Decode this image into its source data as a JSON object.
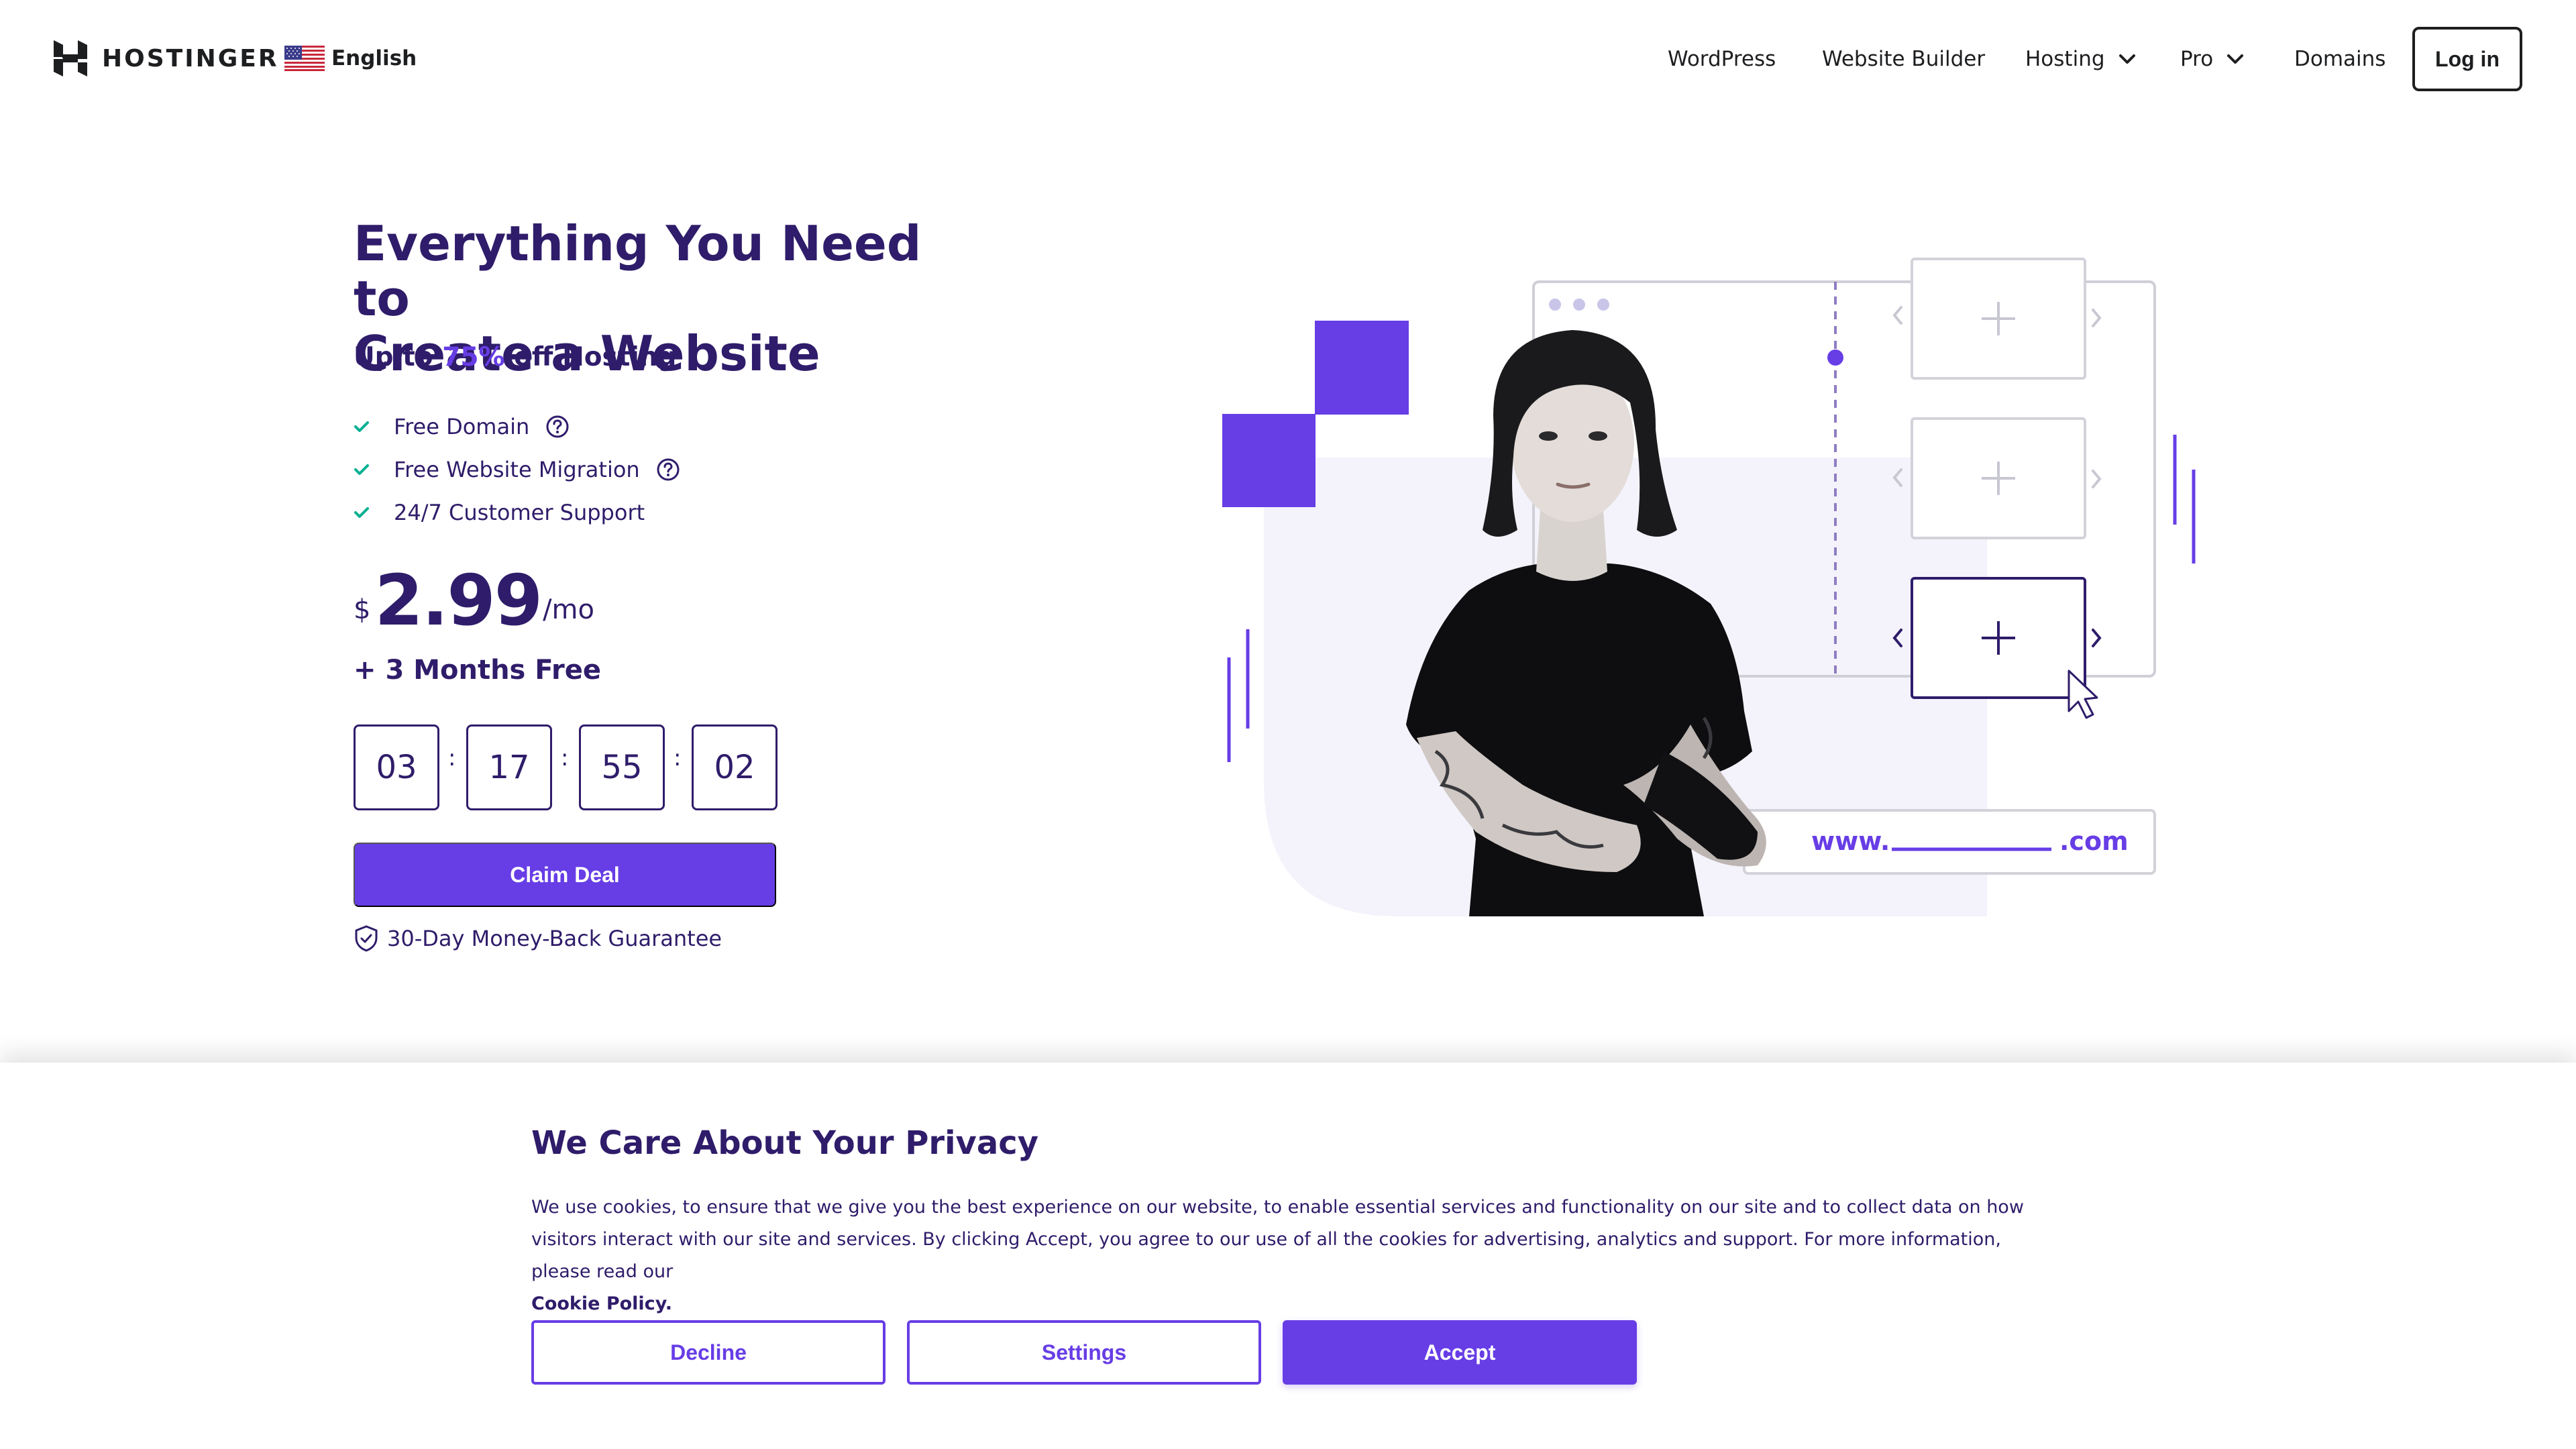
{
  "brand": {
    "name": "HOSTINGER"
  },
  "language": {
    "label": "English",
    "flag_icon": "us-flag-icon"
  },
  "nav": {
    "items": [
      {
        "label": "WordPress",
        "has_dropdown": false
      },
      {
        "label": "Website Builder",
        "has_dropdown": false
      },
      {
        "label": "Hosting",
        "has_dropdown": true
      },
      {
        "label": "Pro",
        "has_dropdown": true
      },
      {
        "label": "Domains",
        "has_dropdown": false
      }
    ],
    "login_label": "Log in"
  },
  "hero": {
    "title_line1": "Everything You Need to",
    "title_line2": "Create a Website",
    "subtitle_prefix": "Up to ",
    "subtitle_accent": "75%",
    "subtitle_suffix": " off Hosting",
    "features": [
      {
        "label": "Free Domain",
        "has_help": true
      },
      {
        "label": "Free Website Migration",
        "has_help": true
      },
      {
        "label": "24/7 Customer Support",
        "has_help": false
      }
    ],
    "price": {
      "currency": "$",
      "amount": "2.99",
      "period": "/mo"
    },
    "bonus": "+ 3 Months Free",
    "countdown": {
      "values": [
        "03",
        "17",
        "55",
        "02"
      ],
      "separator": ":"
    },
    "cta_label": "Claim Deal",
    "guarantee": "30-Day Money-Back Guarantee"
  },
  "illustration": {
    "domain_prefix": "www.",
    "domain_suffix": ".com"
  },
  "cookie_banner": {
    "title": "We Care About Your Privacy",
    "text": "We use cookies, to ensure that we give you the best experience on our website, to enable essential services and functionality on our site and to collect data on how visitors interact with our site and services. By clicking Accept, you agree to our use of all the cookies for advertising, analytics and support. For more information, please read our",
    "link_label": "Cookie Policy.",
    "decline_label": "Decline",
    "settings_label": "Settings",
    "accept_label": "Accept"
  },
  "colors": {
    "primary": "#673de6",
    "dark_text": "#2f1c6a",
    "light_panel": "#f4f3fc",
    "check_green": "#00b090"
  }
}
